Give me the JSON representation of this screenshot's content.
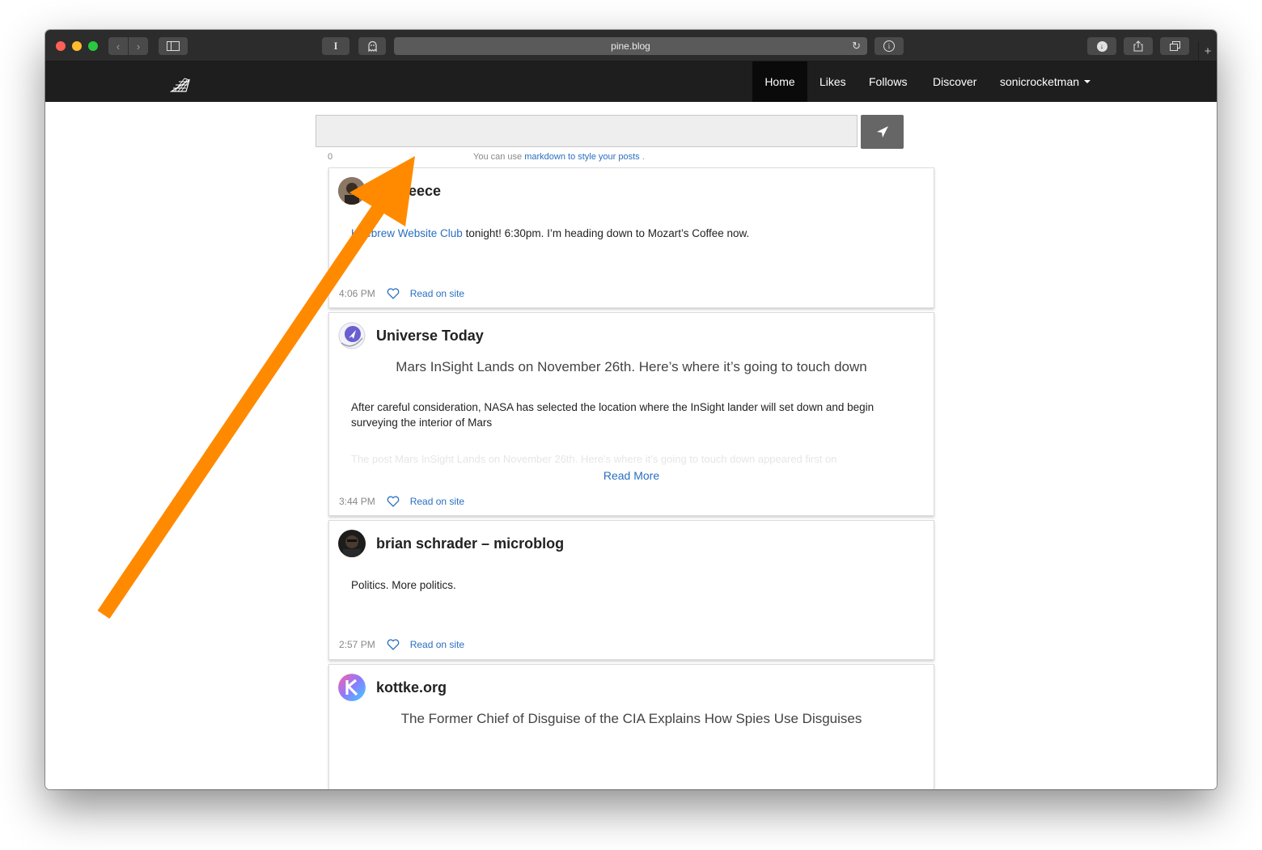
{
  "browser": {
    "url": "pine.blog",
    "reader_button": "I"
  },
  "nav": {
    "items": [
      "Home",
      "Likes",
      "Follows",
      "Discover"
    ],
    "user": "sonicrocketman"
  },
  "composer": {
    "char_count": "0",
    "hint_prefix": "You can use",
    "hint_link": "markdown to style your posts",
    "hint_suffix": "."
  },
  "posts": [
    {
      "author": "on Reece",
      "body_link": "nebrew Website Club",
      "body_prefix": "H",
      "body_text": " tonight! 6:30pm. I’m heading down to Mozart’s Coffee now.",
      "time": "4:06 PM",
      "read_on_site": "Read on site"
    },
    {
      "author": "Universe Today",
      "title": "Mars InSight Lands on November 26th. Here’s where it’s going to touch down",
      "body_text": "After careful consideration, NASA has selected the location where the InSight lander will set down and begin surveying the interior of Mars",
      "faded_text": "The post Mars InSight Lands on November 26th. Here's where it's going to touch down appeared first on",
      "read_more": "Read More",
      "time": "3:44 PM",
      "read_on_site": "Read on site"
    },
    {
      "author": "brian schrader – microblog",
      "body_text": "Politics. More politics.",
      "time": "2:57 PM",
      "read_on_site": "Read on site"
    },
    {
      "author": "kottke.org",
      "title": "The Former Chief of Disguise of the CIA Explains How Spies Use Disguises"
    }
  ],
  "colors": {
    "annotation_arrow": "#ff8a00",
    "link": "#2a6fc0",
    "navbar": "#1e1e1e"
  }
}
